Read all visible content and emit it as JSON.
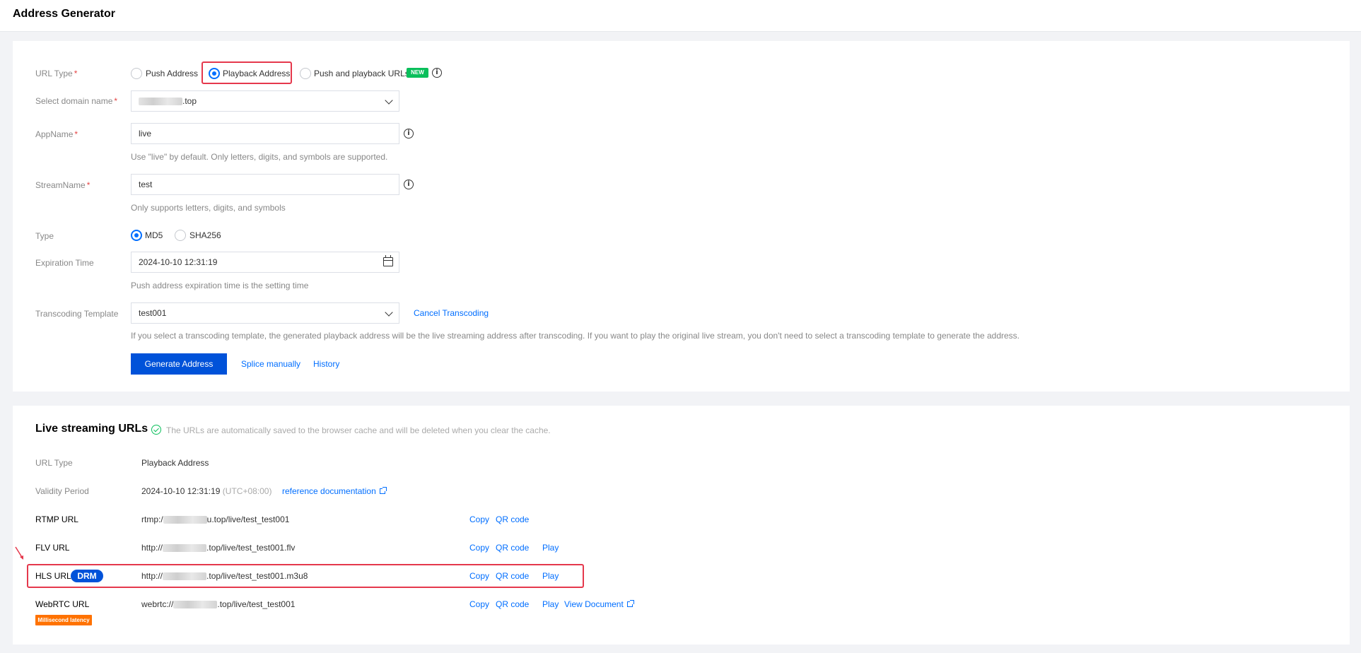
{
  "page": {
    "title": "Address Generator"
  },
  "form": {
    "url_type": {
      "label": "URL Type",
      "required_mark": "*",
      "options": [
        "Push Address",
        "Playback Address",
        "Push and playback URLs"
      ],
      "selected": "Playback Address",
      "new_badge": "NEW"
    },
    "domain": {
      "label": "Select domain name",
      "required_mark": "*",
      "value_suffix": ".top"
    },
    "app_name": {
      "label": "AppName",
      "required_mark": "*",
      "value": "live",
      "hint": "Use \"live\" by default. Only letters, digits, and symbols are supported."
    },
    "stream_name": {
      "label": "StreamName",
      "required_mark": "*",
      "value": "test",
      "hint": "Only supports letters, digits, and symbols"
    },
    "type": {
      "label": "Type",
      "options": [
        "MD5",
        "SHA256"
      ],
      "selected": "MD5"
    },
    "expiration": {
      "label": "Expiration Time",
      "value": "2024-10-10 12:31:19",
      "hint": "Push address expiration time is the setting time"
    },
    "transcoding": {
      "label": "Transcoding Template",
      "value": "test001",
      "cancel_link": "Cancel Transcoding",
      "hint": "If you select a transcoding template, the generated playback address will be the live streaming address after transcoding. If you want to play the original live stream, you don't need to select a transcoding template to generate the address."
    },
    "actions": {
      "generate": "Generate Address",
      "splice": "Splice manually",
      "history": "History"
    }
  },
  "results": {
    "title": "Live streaming URLs",
    "note": "The URLs are automatically saved to the browser cache and will be deleted when you clear the cache.",
    "url_type": {
      "label": "URL Type",
      "value": "Playback Address"
    },
    "validity": {
      "label": "Validity Period",
      "value": "2024-10-10 12:31:19",
      "tz": "(UTC+08:00)",
      "doc_link": "reference documentation"
    },
    "rows": [
      {
        "label": "RTMP URL",
        "prefix": "rtmp:/",
        "suffix": "u.top/live/test_test001",
        "copy": "Copy",
        "qr": "QR code"
      },
      {
        "label": "FLV URL",
        "prefix": "http://",
        "suffix": ".top/live/test_test001.flv",
        "copy": "Copy",
        "qr": "QR code",
        "play": "Play"
      },
      {
        "label": "HLS URL",
        "badge": "DRM",
        "prefix": "http://",
        "suffix": ".top/live/test_test001.m3u8",
        "copy": "Copy",
        "qr": "QR code",
        "play": "Play"
      },
      {
        "label": "WebRTC URL",
        "badge": "Millisecond latency",
        "prefix": "webrtc://",
        "suffix": ".top/live/test_test001",
        "copy": "Copy",
        "qr": "QR code",
        "play": "Play",
        "doc": "View Document"
      }
    ]
  },
  "colors": {
    "primary": "#0052d9",
    "link": "#006eff",
    "highlight": "#e5384c",
    "new_badge": "#0abf5b",
    "latency_badge": "#ff7200"
  }
}
